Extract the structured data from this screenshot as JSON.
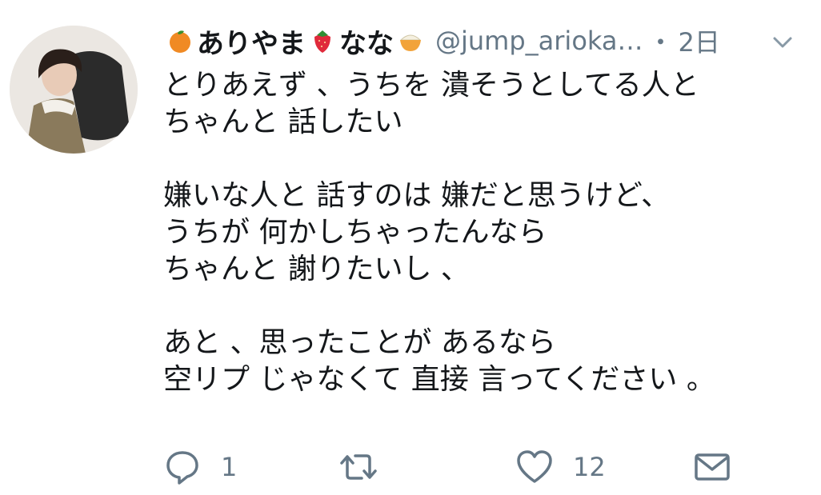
{
  "tweet": {
    "name_part1": "ありやま",
    "name_part2": "なな",
    "handle": "@jump_arioka…",
    "separator": "・",
    "time": "2日",
    "body_lines": [
      "とりあえず 、うちを 潰そうとしてる人と",
      "ちゃんと 話したい",
      "",
      "嫌いな人と 話すのは 嫌だと思うけど、",
      "うちが 何かしちゃったんなら",
      "ちゃんと 謝りたいし 、",
      "",
      "あと 、思ったことが あるなら",
      "空リプ じゃなくて 直接 言ってください 。"
    ]
  },
  "actions": {
    "reply_count": "1",
    "retweet_count": "",
    "like_count": "12"
  },
  "icons": {
    "name_emoji_1": "tangerine-icon",
    "name_emoji_2": "strawberry-icon",
    "name_emoji_3": "rice-bowl-icon",
    "more": "chevron-down-icon",
    "reply": "reply-icon",
    "retweet": "retweet-icon",
    "like": "heart-icon",
    "dm": "envelope-icon"
  },
  "colors": {
    "text": "#14171a",
    "secondary": "#657786",
    "icon_gray": "#657786"
  }
}
